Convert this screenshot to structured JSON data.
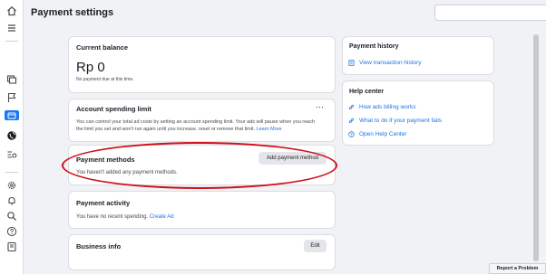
{
  "header": {
    "title": "Payment settings"
  },
  "balance": {
    "title": "Current balance",
    "amount": "Rp 0",
    "note": "No payment due at this time."
  },
  "spending_limit": {
    "title": "Account spending limit",
    "more": "⋯",
    "line1": "You can control your total ad costs by setting an account spending limit. Your ads will pause when you reach",
    "line2_prefix": "the limit you set and won't run again until you increase, reset or remove that limit. ",
    "learn_more": "Learn More"
  },
  "payment_methods": {
    "title": "Payment methods",
    "button": "Add payment method",
    "empty": "You haven't added any payment methods."
  },
  "activity": {
    "title": "Payment activity",
    "prefix": "You have no recent spending. ",
    "link": "Create Ad"
  },
  "business": {
    "title": "Business info",
    "button": "Edit"
  },
  "history": {
    "title": "Payment history",
    "link": "View transaction history"
  },
  "help": {
    "title": "Help center",
    "items": [
      "How ads billing works",
      "What to do if your payment fails",
      "Open Help Center"
    ]
  },
  "report": {
    "label": "Report a Problem"
  },
  "colors": {
    "accent": "#1b74e4",
    "highlight": "#d0101b",
    "active_rail": "#1877f2"
  },
  "icons": [
    "home-icon",
    "menu-icon",
    "overview-icon",
    "flag-icon",
    "billing-icon",
    "globe-icon",
    "settings-list-icon",
    "gear-icon",
    "bell-icon",
    "search-icon",
    "help-icon",
    "report-icon"
  ]
}
